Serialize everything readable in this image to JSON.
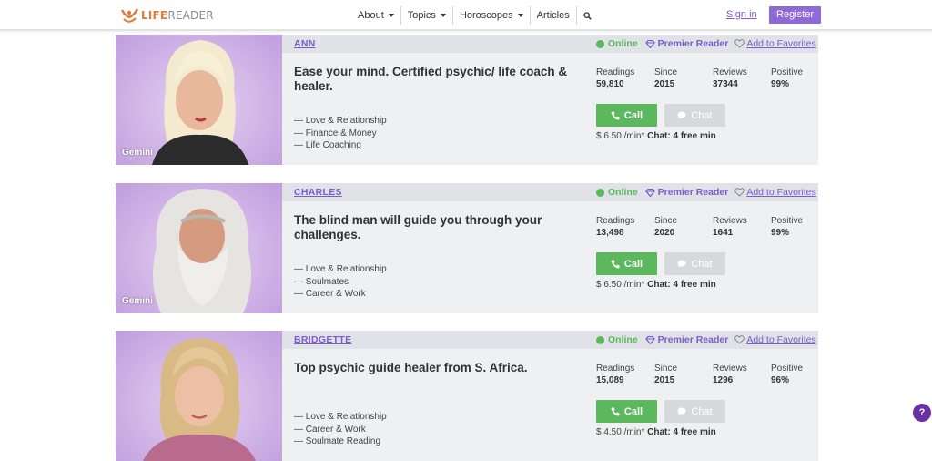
{
  "header": {
    "logo_text_1": "LIFE",
    "logo_text_2": "READER",
    "nav": [
      {
        "label": "About",
        "has_caret": true
      },
      {
        "label": "Topics",
        "has_caret": true
      },
      {
        "label": "Horoscopes",
        "has_caret": true
      },
      {
        "label": "Articles",
        "has_caret": false
      }
    ],
    "search_icon": "search-icon",
    "signin_label": "Sign in",
    "register_label": "Register"
  },
  "labels": {
    "online": "Online",
    "premier": "Premier Reader",
    "favorites": "Add to Favorites",
    "readings": "Readings",
    "since": "Since",
    "reviews": "Reviews",
    "positive": "Positive",
    "call": "Call",
    "chat": "Chat",
    "chat_free": "Chat: 4 free min"
  },
  "readers": [
    {
      "name": "ANN",
      "sign": "Gemini",
      "headline": "Ease your mind. Certified psychic/ life coach & healer.",
      "topics": [
        "— Love & Relationship",
        "— Finance & Money",
        "— Life Coaching"
      ],
      "readings": "59,810",
      "since": "2015",
      "reviews": "37344",
      "positive": "99%",
      "price": "$ 6.50 /min*"
    },
    {
      "name": "CHARLES",
      "sign": "Gemini",
      "headline": "The blind man will guide you through your challenges.",
      "topics": [
        "— Love & Relationship",
        "— Soulmates",
        "— Career & Work"
      ],
      "readings": "13,498",
      "since": "2020",
      "reviews": "1641",
      "positive": "99%",
      "price": "$ 6.50 /min*"
    },
    {
      "name": "BRIDGETTE",
      "sign": "",
      "headline": "Top psychic guide healer from S. Africa.",
      "topics": [
        "— Love & Relationship",
        "— Career & Work",
        "— Soulmate Reading"
      ],
      "readings": "15,089",
      "since": "2015",
      "reviews": "1296",
      "positive": "96%",
      "price": "$ 4.50 /min*"
    }
  ],
  "help_label": "?",
  "colors": {
    "brand_purple": "#7d5ccf",
    "register_bg": "#8d6ad6",
    "online_green": "#5cb85c",
    "logo_orange": "#e07b39",
    "card_bg": "#eef0f2"
  }
}
